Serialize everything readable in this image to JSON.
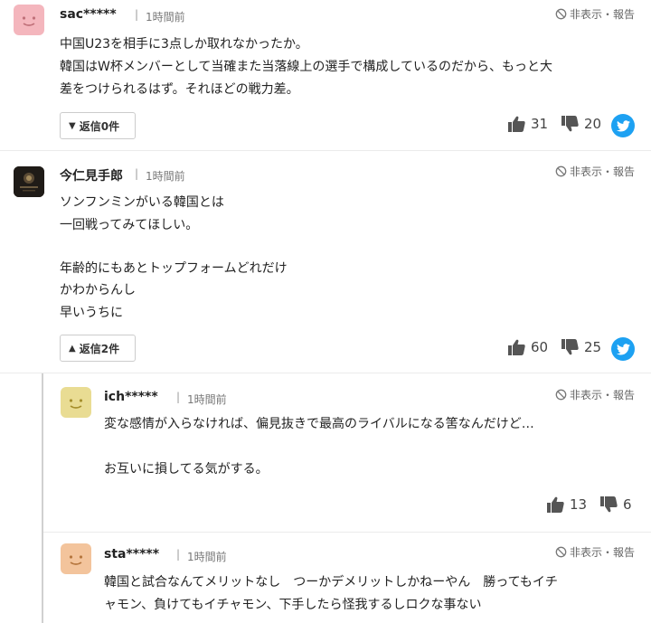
{
  "comments": [
    {
      "name": "sac*****",
      "time": "1時間前",
      "hide_report": "非表示・報告",
      "lines": [
        "中国U23を相手に3点しか取れなかったか。",
        "韓国はW杯メンバーとして当確また当落線上の選手で構成しているのだから、もっと大",
        "差をつけられるはず。それほどの戦力差。"
      ],
      "reply_label": "返信",
      "reply_count": "0件",
      "reply_arrow": "▼",
      "likes": "31",
      "dislikes": "20",
      "avatar": "smiley-pink"
    },
    {
      "name": "今仁見手郎",
      "time": "1時間前",
      "hide_report": "非表示・報告",
      "lines": [
        "ソンフンミンがいる韓国とは",
        "一回戦ってみてほしい。",
        "",
        "年齢的にもあとトップフォームどれだけ",
        "かわからんし",
        "早いうちに"
      ],
      "reply_label": "返信",
      "reply_count": "2件",
      "reply_arrow": "▲",
      "likes": "60",
      "dislikes": "25",
      "avatar": "photo-dark"
    }
  ],
  "replies": [
    {
      "name": "ich*****",
      "time": "1時間前",
      "hide_report": "非表示・報告",
      "lines": [
        "変な感情が入らなければ、偏見抜きで最高のライバルになる筈なんだけど…",
        "",
        "お互いに損してる気がする。"
      ],
      "likes": "13",
      "dislikes": "6",
      "avatar": "smiley-yellow"
    },
    {
      "name": "sta*****",
      "time": "1時間前",
      "hide_report": "非表示・報告",
      "lines": [
        "韓国と試合なんてメリットなし　つーかデメリットしかねーやん　勝ってもイチ",
        "ャモン、負けてもイチャモン、下手したら怪我するしロクな事ない"
      ],
      "avatar": "smiley-orange"
    }
  ],
  "colors": {
    "twitter": "#1da1f2",
    "pink": "#f4b6bd",
    "yellow": "#e9dc93",
    "orange": "#f3c49c"
  }
}
